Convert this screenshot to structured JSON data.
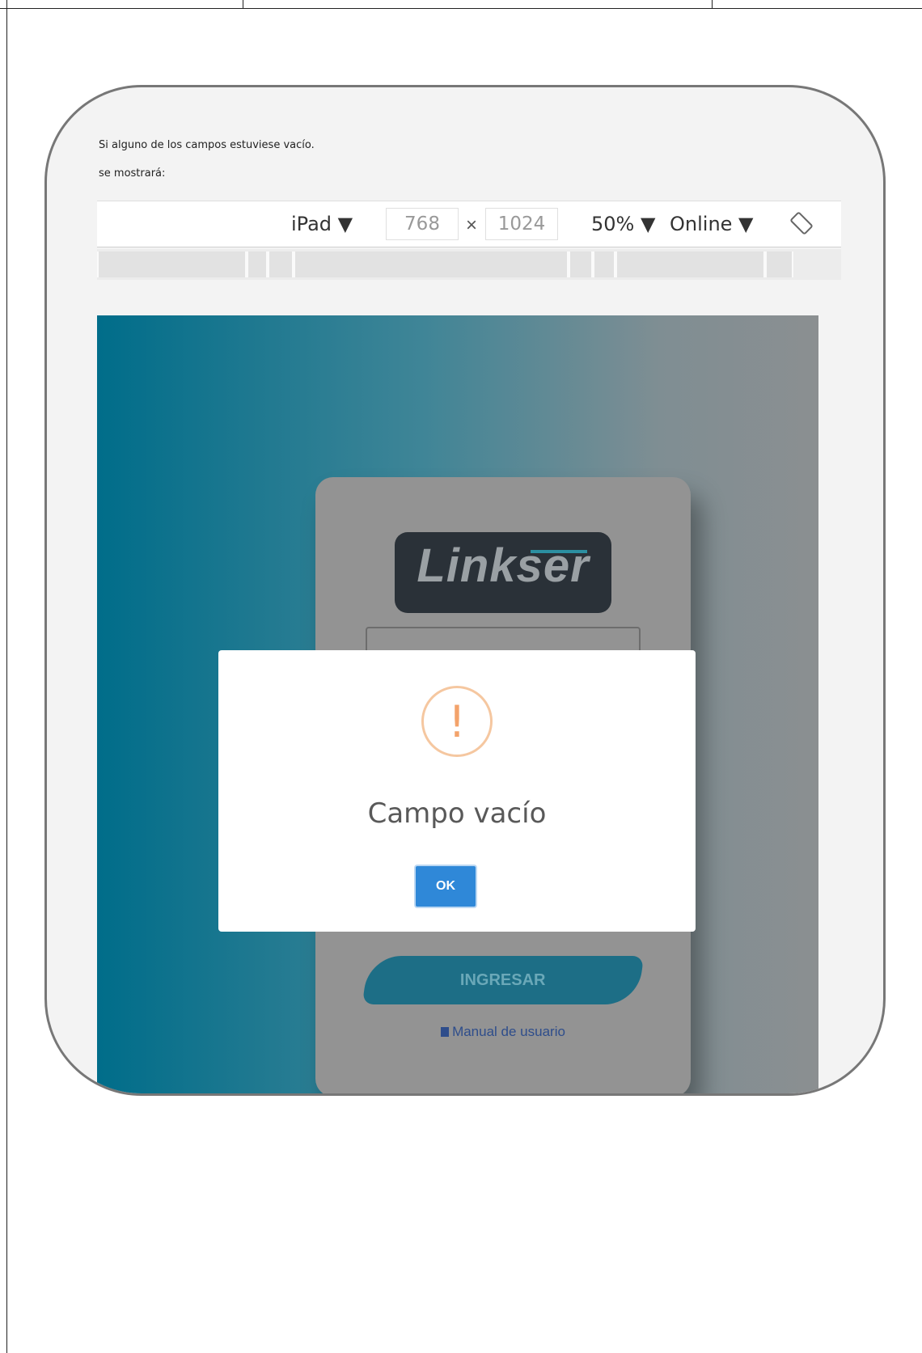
{
  "doc": {
    "intro_line1": "Si alguno de los campos estuviese vacío.",
    "intro_line2": "se mostrará:"
  },
  "devtools": {
    "device": "iPad ▼",
    "width": "768",
    "times": "×",
    "height": "1024",
    "zoom": "50% ▼",
    "network": "Online ▼",
    "rotate_icon": "rotate-icon"
  },
  "login": {
    "logo_text": "Linkser",
    "submit_label": "INGRESAR",
    "manual_link": "Manual de usuario"
  },
  "alert": {
    "icon": "!",
    "title": "Campo vacío",
    "ok_label": "OK"
  },
  "colors": {
    "ok_button": "#2f88d8",
    "warning": "#f3a36b",
    "gradient_start": "#006d8a",
    "gradient_end": "#8b8f91"
  }
}
